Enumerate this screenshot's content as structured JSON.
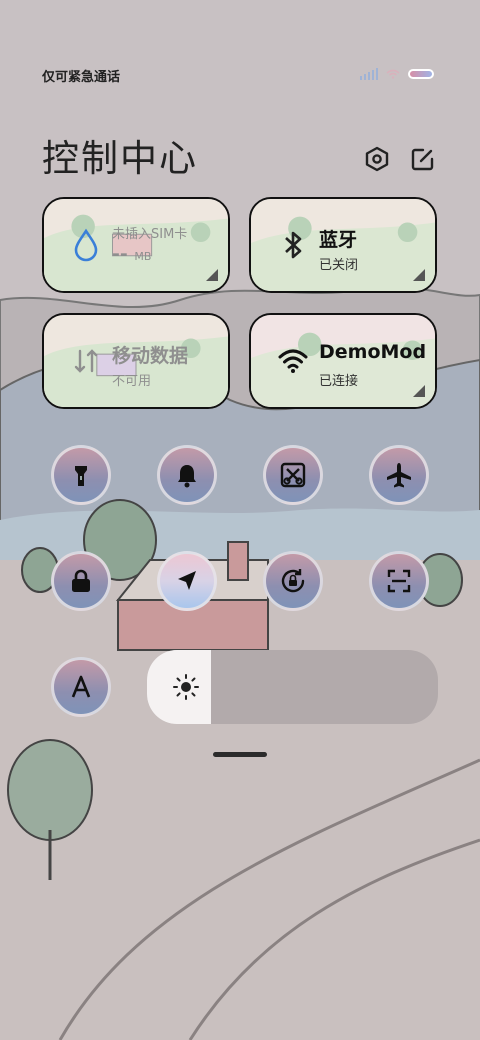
{
  "status_bar": {
    "carrier_text": "仅可紧急通话"
  },
  "header": {
    "title": "控制中心",
    "settings_icon": "settings-hex-icon",
    "edit_icon": "edit-icon"
  },
  "tiles": [
    {
      "id": "data-usage",
      "icon": "water-drop-icon",
      "main": "--",
      "unit": "MB",
      "sub": "未插入SIM卡",
      "state": "dim"
    },
    {
      "id": "bluetooth",
      "icon": "bluetooth-icon",
      "main": "蓝牙",
      "sub": "已关闭",
      "state": "off"
    },
    {
      "id": "mobile-data",
      "icon": "mobile-data-icon",
      "main": "移动数据",
      "sub": "不可用",
      "state": "dim"
    },
    {
      "id": "wifi",
      "icon": "wifi-icon",
      "main": "DemoMod",
      "sub": "已连接",
      "state": "on"
    }
  ],
  "toggles": [
    {
      "id": "flashlight",
      "icon": "flashlight-icon",
      "active": false
    },
    {
      "id": "ringer",
      "icon": "bell-icon",
      "active": false
    },
    {
      "id": "screenshot",
      "icon": "screenshot-scissors-icon",
      "active": false
    },
    {
      "id": "airplane",
      "icon": "airplane-icon",
      "active": false
    },
    {
      "id": "lock-screen",
      "icon": "lock-icon",
      "active": false
    },
    {
      "id": "location",
      "icon": "location-arrow-icon",
      "active": true
    },
    {
      "id": "auto-rotate",
      "icon": "rotation-lock-icon",
      "active": false
    },
    {
      "id": "scanner",
      "icon": "scan-icon",
      "active": false
    },
    {
      "id": "text-size",
      "icon": "letter-a-icon",
      "active": false
    }
  ],
  "brightness": {
    "level_percent": 22,
    "icon": "sun-icon"
  },
  "colors": {
    "tile_border": "#111111",
    "toggle_gradient_top": "#c39aa8",
    "toggle_gradient_bottom": "#7f93b8",
    "wifi_accent": "#3a7fd8"
  }
}
